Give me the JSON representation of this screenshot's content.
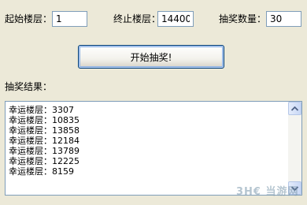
{
  "form": {
    "start_floor_label": "起始楼层：",
    "start_floor_value": "1",
    "end_floor_label": "终止楼层：",
    "end_floor_value": "14400",
    "draw_count_label": "抽奖数量：",
    "draw_count_value": "30"
  },
  "actions": {
    "start_button_label": "开始抽奖!"
  },
  "results": {
    "label": "抽奖结果：",
    "items": [
      "幸运楼层：3307",
      "幸运楼层：10835",
      "幸运楼层：13858",
      "幸运楼层：12184",
      "幸运楼层：13789",
      "幸运楼层：12225",
      "幸运楼层：8159"
    ]
  },
  "scrollbar": {
    "up_icon": "arrow-up-icon",
    "down_icon": "arrow-down-icon",
    "accent_color": "#4D6185"
  },
  "watermark": {
    "text": "3H€ 当游网"
  }
}
